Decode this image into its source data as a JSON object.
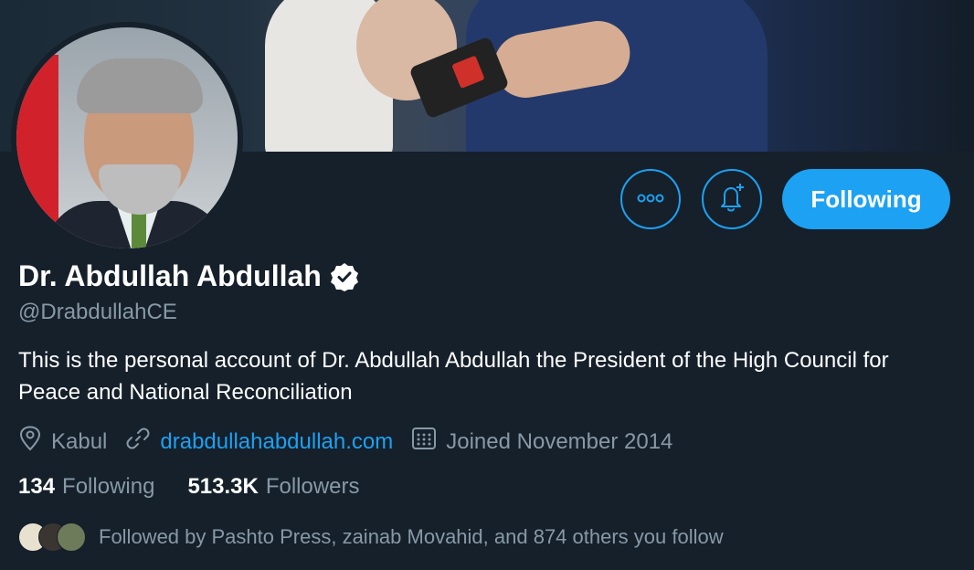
{
  "profile": {
    "display_name": "Dr. Abdullah Abdullah",
    "verified": true,
    "handle": "@DrabdullahCE",
    "bio": "This is the personal account of Dr. Abdullah Abdullah the President of the High Council for Peace and National Reconciliation",
    "location": "Kabul",
    "website": "drabdullahabdullah.com",
    "joined": "Joined November 2014"
  },
  "actions": {
    "follow_label": "Following"
  },
  "stats": {
    "following_count": "134",
    "following_label": "Following",
    "followers_count": "513.3K",
    "followers_label": "Followers"
  },
  "followed_by": {
    "text": "Followed by Pashto Press, zainab Movahid, and 874 others you follow"
  },
  "icons": {
    "more": "more-icon",
    "notify": "bell-plus-icon",
    "verified": "verified-badge-icon",
    "location": "location-pin-icon",
    "link": "link-icon",
    "calendar": "calendar-icon"
  },
  "colors": {
    "background": "#15202b",
    "accent": "#1da1f2",
    "secondary_text": "#8899a6"
  }
}
